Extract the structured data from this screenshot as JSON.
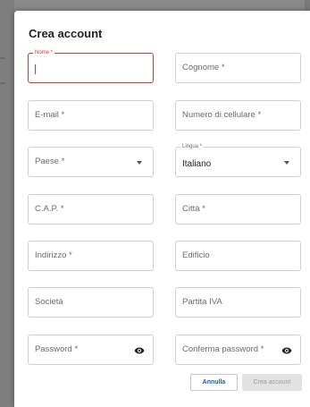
{
  "dialog": {
    "title": "Crea account"
  },
  "fields": {
    "nome": {
      "label": "Nome *",
      "value": ""
    },
    "cognome": {
      "placeholder": "Cognome *"
    },
    "email": {
      "placeholder": "E-mail *"
    },
    "cellulare": {
      "placeholder": "Numero di cellulare *"
    },
    "paese": {
      "placeholder": "Paese *"
    },
    "lingua": {
      "label": "Lingua *",
      "value": "Italiano"
    },
    "cap": {
      "placeholder": "C.A.P. *"
    },
    "citta": {
      "placeholder": "Città *"
    },
    "indirizzo": {
      "placeholder": "Indirizzo *"
    },
    "edificio": {
      "placeholder": "Edificio"
    },
    "societa": {
      "placeholder": "Società"
    },
    "partita_iva": {
      "placeholder": "Partita IVA"
    },
    "password": {
      "placeholder": "Password *",
      "icon": "eye-icon"
    },
    "conferma_password": {
      "placeholder": "Conferma password *",
      "icon": "eye-icon"
    }
  },
  "buttons": {
    "cancel": "Annulla",
    "create": "Crea account"
  },
  "colors": {
    "focus": "#d93636",
    "link": "#1a5fb4",
    "disabled_bg": "#e2e2e2",
    "disabled_text": "#9a9a9a"
  }
}
